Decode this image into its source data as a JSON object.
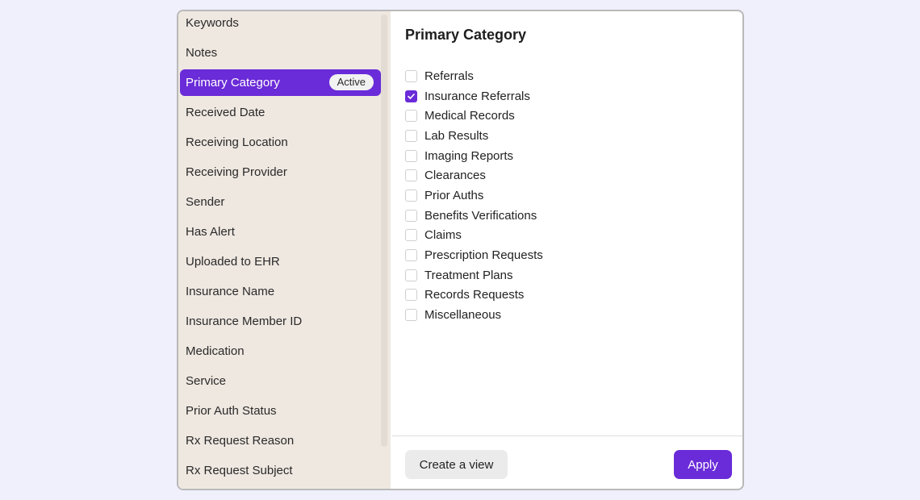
{
  "colors": {
    "background": "#f0effc",
    "sidebar": "#efe8e1",
    "accent": "#6a2bd8"
  },
  "sidebar": {
    "items": [
      {
        "label": "Keywords"
      },
      {
        "label": "Notes"
      },
      {
        "label": "Primary Category",
        "active": true,
        "badge": "Active"
      },
      {
        "label": "Received Date"
      },
      {
        "label": "Receiving Location"
      },
      {
        "label": "Receiving Provider"
      },
      {
        "label": "Sender"
      },
      {
        "label": "Has Alert"
      },
      {
        "label": "Uploaded to EHR"
      },
      {
        "label": "Insurance Name"
      },
      {
        "label": "Insurance Member ID"
      },
      {
        "label": "Medication"
      },
      {
        "label": "Service"
      },
      {
        "label": "Prior Auth Status"
      },
      {
        "label": "Rx Request Reason"
      },
      {
        "label": "Rx Request Subject"
      }
    ]
  },
  "main": {
    "title": "Primary Category",
    "options": [
      {
        "label": "Referrals",
        "checked": false
      },
      {
        "label": "Insurance Referrals",
        "checked": true
      },
      {
        "label": "Medical Records",
        "checked": false
      },
      {
        "label": "Lab Results",
        "checked": false
      },
      {
        "label": "Imaging Reports",
        "checked": false
      },
      {
        "label": "Clearances",
        "checked": false
      },
      {
        "label": "Prior Auths",
        "checked": false
      },
      {
        "label": "Benefits Verifications",
        "checked": false
      },
      {
        "label": "Claims",
        "checked": false
      },
      {
        "label": "Prescription Requests",
        "checked": false
      },
      {
        "label": "Treatment Plans",
        "checked": false
      },
      {
        "label": "Records Requests",
        "checked": false
      },
      {
        "label": "Miscellaneous",
        "checked": false
      }
    ]
  },
  "footer": {
    "create_view_label": "Create a view",
    "apply_label": "Apply"
  }
}
